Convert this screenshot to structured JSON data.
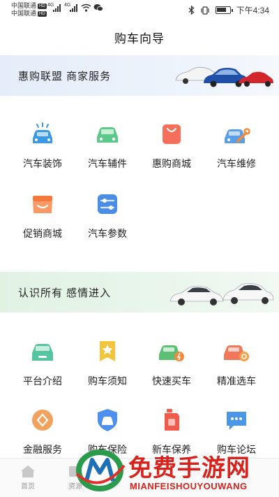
{
  "status_bar": {
    "carrier_1": "中国联通",
    "carrier_2": "中国联通",
    "hd_badge": "HD",
    "net_1": "4G",
    "net_2": "4G",
    "time": "下午4:34",
    "icons": [
      "bluetooth-icon",
      "vibrate-icon",
      "battery-icon",
      "wifi-icon",
      "wechat-icon"
    ]
  },
  "header": {
    "title": "购车向导"
  },
  "banner_1": {
    "text": "惠购联盟 商家服务"
  },
  "section_1": {
    "items": [
      {
        "label": "汽车装饰",
        "icon": "car-wash-icon",
        "color": "#3b9ae6"
      },
      {
        "label": "汽车辅件",
        "icon": "car-icon",
        "color": "#5cc98a"
      },
      {
        "label": "惠购商城",
        "icon": "shopping-bag-icon",
        "color": "#f56f5a"
      },
      {
        "label": "汽车维修",
        "icon": "car-repair-icon",
        "color": "#5a9ee8"
      },
      {
        "label": "促销商城",
        "icon": "store-icon",
        "color": "#f47a3c"
      },
      {
        "label": "汽车参数",
        "icon": "sliders-icon",
        "color": "#4b8de5"
      }
    ]
  },
  "banner_2": {
    "text": "认识所有 感情进入"
  },
  "section_2": {
    "items": [
      {
        "label": "平台介绍",
        "icon": "car-front-icon",
        "color": "#56c4a0"
      },
      {
        "label": "购车须知",
        "icon": "star-badge-icon",
        "color": "#f2c53a"
      },
      {
        "label": "快速买车",
        "icon": "fast-car-icon",
        "color": "#5dbf73"
      },
      {
        "label": "精准选车",
        "icon": "target-car-icon",
        "color": "#f2775a"
      },
      {
        "label": "金融服务",
        "icon": "finance-icon",
        "color": "#f3a25e"
      },
      {
        "label": "购车保险",
        "icon": "insurance-car-icon",
        "color": "#4f8ff0"
      },
      {
        "label": "新车保养",
        "icon": "oil-can-icon",
        "color": "#f25a4a"
      },
      {
        "label": "购车论坛",
        "icon": "forum-chat-icon",
        "color": "#4a96e8"
      }
    ]
  },
  "bottom_nav": {
    "items": [
      {
        "label": "首页",
        "icon": "home-icon"
      },
      {
        "label": "资源",
        "icon": "resource-icon"
      }
    ]
  },
  "watermark": {
    "main": "免费手游网",
    "sub": "MIANFEISHOUYOUWANG"
  }
}
